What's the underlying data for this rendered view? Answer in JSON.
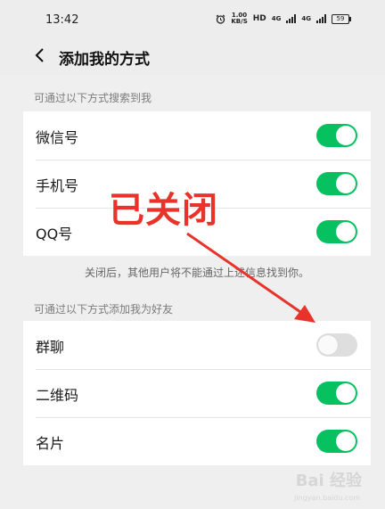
{
  "status_bar": {
    "time": "13:42",
    "speed_value": "1.00",
    "speed_unit": "KB/S",
    "hd_label": "HD",
    "signal1_label": "4G",
    "signal2_label": "4G",
    "battery_level": "59"
  },
  "nav": {
    "title": "添加我的方式"
  },
  "section_search": {
    "label": "可通过以下方式搜索到我",
    "items": [
      {
        "label": "微信号",
        "enabled": true
      },
      {
        "label": "手机号",
        "enabled": true
      },
      {
        "label": "QQ号",
        "enabled": true
      }
    ]
  },
  "search_note": "关闭后，其他用户将不能通过上述信息找到你。",
  "section_add": {
    "label": "可通过以下方式添加我为好友",
    "items": [
      {
        "label": "群聊",
        "enabled": false
      },
      {
        "label": "二维码",
        "enabled": true
      },
      {
        "label": "名片",
        "enabled": true
      }
    ]
  },
  "annotation": {
    "text": "已关闭",
    "color": "#e8332b"
  },
  "watermark": {
    "text": "Bai 经验",
    "sub": "jingyan.baidu.com"
  },
  "colors": {
    "toggle_on": "#07c160",
    "toggle_off": "#dedede",
    "background": "#efefef"
  }
}
